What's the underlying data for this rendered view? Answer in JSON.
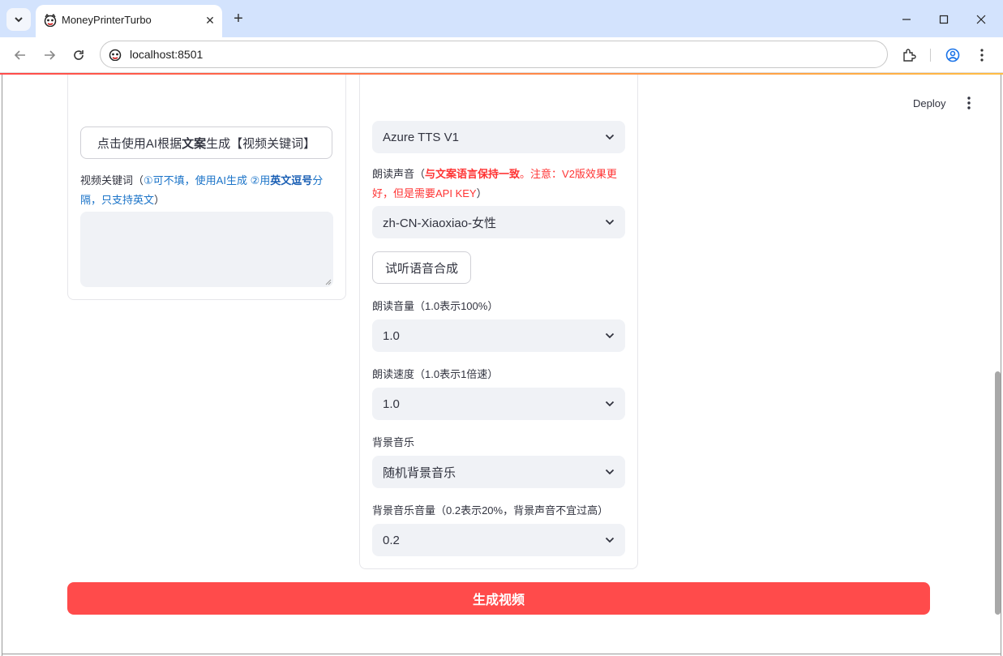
{
  "browser": {
    "tab_title": "MoneyPrinterTurbo",
    "url": "localhost:8501"
  },
  "header": {
    "deploy_label": "Deploy"
  },
  "left_panel": {
    "ai_keywords_button": {
      "part1": "点击使用AI根据",
      "part2": "文案",
      "part3": "生成【视频关键词】"
    },
    "keywords_label": {
      "prefix": "视频关键词（",
      "hint1": "①可不填，使用AI生成 ②用",
      "hint2": "英文逗号",
      "hint3": "分隔，只支持英文",
      "suffix": "）"
    },
    "keywords_value": ""
  },
  "mid_panel": {
    "tts_server": "Azure TTS V1",
    "voice_label": {
      "prefix": "朗读声音（",
      "bold": "与文案语言保持一致",
      "rest": "。注意：V2版效果更好，但是需要API KEY",
      "suffix": "）"
    },
    "voice_value": "zh-CN-Xiaoxiao-女性",
    "preview_button": "试听语音合成",
    "volume_label": "朗读音量（1.0表示100%）",
    "volume_value": "1.0",
    "speed_label": "朗读速度（1.0表示1倍速）",
    "speed_value": "1.0",
    "bgm_label": "背景音乐",
    "bgm_value": "随机背景音乐",
    "bgm_volume_label": "背景音乐音量（0.2表示20%，背景声音不宜过高）",
    "bgm_volume_value": "0.2"
  },
  "generate_button": "生成视频",
  "colors": {
    "primary": "#ff4b4b",
    "warning_text": "#ff3333",
    "hint_text": "#1a73c8",
    "select_bg": "#f0f2f6"
  }
}
